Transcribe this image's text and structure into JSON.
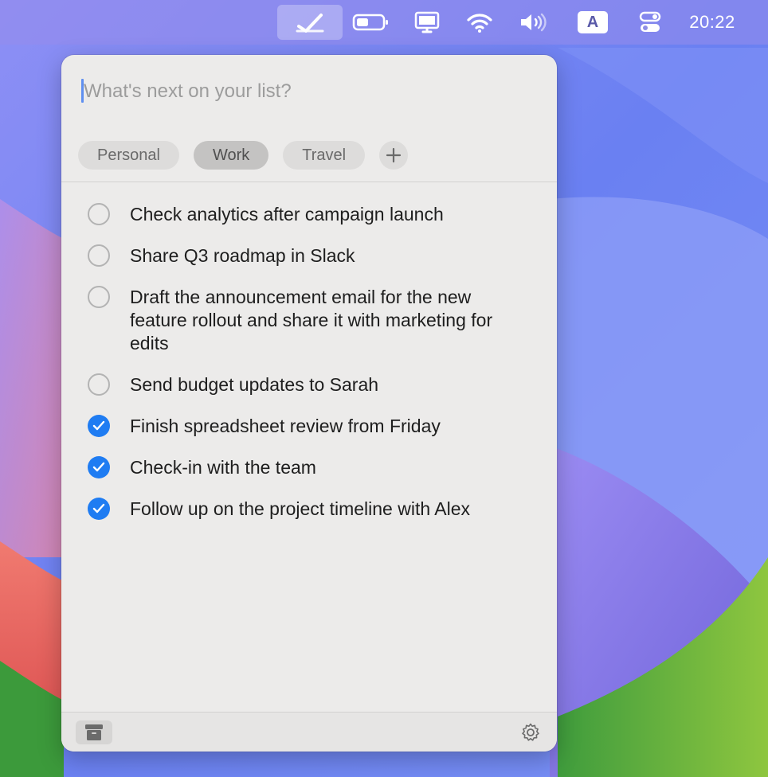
{
  "menubar": {
    "input_source": "A",
    "clock": "20:22",
    "icons": [
      "checkmark-app-icon",
      "battery-icon",
      "display-icon",
      "wifi-icon",
      "volume-icon",
      "input-source-icon",
      "control-center-icon"
    ]
  },
  "panel": {
    "entry_placeholder": "What's next on your list?",
    "tabs": [
      {
        "label": "Personal",
        "selected": false
      },
      {
        "label": "Work",
        "selected": true
      },
      {
        "label": "Travel",
        "selected": false
      }
    ],
    "items": [
      {
        "text": "Check analytics after campaign launch",
        "done": false
      },
      {
        "text": "Share Q3 roadmap in Slack",
        "done": false
      },
      {
        "text": "Draft the announcement email for the new feature rollout and share it with marketing for edits",
        "done": false
      },
      {
        "text": "Send budget updates to Sarah",
        "done": false
      },
      {
        "text": "Finish spreadsheet review from Friday",
        "done": true
      },
      {
        "text": "Check-in with the team",
        "done": true
      },
      {
        "text": "Follow up on the project timeline with Alex",
        "done": true
      }
    ],
    "footer_icons": [
      "archive-icon",
      "gear-icon"
    ]
  },
  "colors": {
    "accent": "#1f7cf2",
    "panel_bg": "#ecebea",
    "tab_bg": "#dddcdb",
    "tab_selected_bg": "#c4c3c2"
  }
}
